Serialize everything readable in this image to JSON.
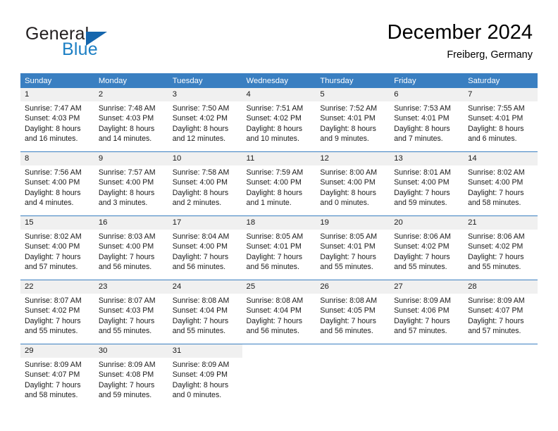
{
  "brand": {
    "word_one": "General",
    "word_two": "Blue",
    "logo_icon": "triangle-logo-icon",
    "accent_color": "#1566ad",
    "text_color": "#1c7fc4"
  },
  "header": {
    "month_title": "December 2024",
    "location": "Freiberg, Germany"
  },
  "calendar": {
    "header_background": "#3a7fc1",
    "day_number_background": "#f0f0f0",
    "weekdays": [
      "Sunday",
      "Monday",
      "Tuesday",
      "Wednesday",
      "Thursday",
      "Friday",
      "Saturday"
    ],
    "weeks": [
      [
        {
          "day": "1",
          "sunrise": "Sunrise: 7:47 AM",
          "sunset": "Sunset: 4:03 PM",
          "daylight_line1": "Daylight: 8 hours",
          "daylight_line2": "and 16 minutes."
        },
        {
          "day": "2",
          "sunrise": "Sunrise: 7:48 AM",
          "sunset": "Sunset: 4:03 PM",
          "daylight_line1": "Daylight: 8 hours",
          "daylight_line2": "and 14 minutes."
        },
        {
          "day": "3",
          "sunrise": "Sunrise: 7:50 AM",
          "sunset": "Sunset: 4:02 PM",
          "daylight_line1": "Daylight: 8 hours",
          "daylight_line2": "and 12 minutes."
        },
        {
          "day": "4",
          "sunrise": "Sunrise: 7:51 AM",
          "sunset": "Sunset: 4:02 PM",
          "daylight_line1": "Daylight: 8 hours",
          "daylight_line2": "and 10 minutes."
        },
        {
          "day": "5",
          "sunrise": "Sunrise: 7:52 AM",
          "sunset": "Sunset: 4:01 PM",
          "daylight_line1": "Daylight: 8 hours",
          "daylight_line2": "and 9 minutes."
        },
        {
          "day": "6",
          "sunrise": "Sunrise: 7:53 AM",
          "sunset": "Sunset: 4:01 PM",
          "daylight_line1": "Daylight: 8 hours",
          "daylight_line2": "and 7 minutes."
        },
        {
          "day": "7",
          "sunrise": "Sunrise: 7:55 AM",
          "sunset": "Sunset: 4:01 PM",
          "daylight_line1": "Daylight: 8 hours",
          "daylight_line2": "and 6 minutes."
        }
      ],
      [
        {
          "day": "8",
          "sunrise": "Sunrise: 7:56 AM",
          "sunset": "Sunset: 4:00 PM",
          "daylight_line1": "Daylight: 8 hours",
          "daylight_line2": "and 4 minutes."
        },
        {
          "day": "9",
          "sunrise": "Sunrise: 7:57 AM",
          "sunset": "Sunset: 4:00 PM",
          "daylight_line1": "Daylight: 8 hours",
          "daylight_line2": "and 3 minutes."
        },
        {
          "day": "10",
          "sunrise": "Sunrise: 7:58 AM",
          "sunset": "Sunset: 4:00 PM",
          "daylight_line1": "Daylight: 8 hours",
          "daylight_line2": "and 2 minutes."
        },
        {
          "day": "11",
          "sunrise": "Sunrise: 7:59 AM",
          "sunset": "Sunset: 4:00 PM",
          "daylight_line1": "Daylight: 8 hours",
          "daylight_line2": "and 1 minute."
        },
        {
          "day": "12",
          "sunrise": "Sunrise: 8:00 AM",
          "sunset": "Sunset: 4:00 PM",
          "daylight_line1": "Daylight: 8 hours",
          "daylight_line2": "and 0 minutes."
        },
        {
          "day": "13",
          "sunrise": "Sunrise: 8:01 AM",
          "sunset": "Sunset: 4:00 PM",
          "daylight_line1": "Daylight: 7 hours",
          "daylight_line2": "and 59 minutes."
        },
        {
          "day": "14",
          "sunrise": "Sunrise: 8:02 AM",
          "sunset": "Sunset: 4:00 PM",
          "daylight_line1": "Daylight: 7 hours",
          "daylight_line2": "and 58 minutes."
        }
      ],
      [
        {
          "day": "15",
          "sunrise": "Sunrise: 8:02 AM",
          "sunset": "Sunset: 4:00 PM",
          "daylight_line1": "Daylight: 7 hours",
          "daylight_line2": "and 57 minutes."
        },
        {
          "day": "16",
          "sunrise": "Sunrise: 8:03 AM",
          "sunset": "Sunset: 4:00 PM",
          "daylight_line1": "Daylight: 7 hours",
          "daylight_line2": "and 56 minutes."
        },
        {
          "day": "17",
          "sunrise": "Sunrise: 8:04 AM",
          "sunset": "Sunset: 4:00 PM",
          "daylight_line1": "Daylight: 7 hours",
          "daylight_line2": "and 56 minutes."
        },
        {
          "day": "18",
          "sunrise": "Sunrise: 8:05 AM",
          "sunset": "Sunset: 4:01 PM",
          "daylight_line1": "Daylight: 7 hours",
          "daylight_line2": "and 56 minutes."
        },
        {
          "day": "19",
          "sunrise": "Sunrise: 8:05 AM",
          "sunset": "Sunset: 4:01 PM",
          "daylight_line1": "Daylight: 7 hours",
          "daylight_line2": "and 55 minutes."
        },
        {
          "day": "20",
          "sunrise": "Sunrise: 8:06 AM",
          "sunset": "Sunset: 4:02 PM",
          "daylight_line1": "Daylight: 7 hours",
          "daylight_line2": "and 55 minutes."
        },
        {
          "day": "21",
          "sunrise": "Sunrise: 8:06 AM",
          "sunset": "Sunset: 4:02 PM",
          "daylight_line1": "Daylight: 7 hours",
          "daylight_line2": "and 55 minutes."
        }
      ],
      [
        {
          "day": "22",
          "sunrise": "Sunrise: 8:07 AM",
          "sunset": "Sunset: 4:02 PM",
          "daylight_line1": "Daylight: 7 hours",
          "daylight_line2": "and 55 minutes."
        },
        {
          "day": "23",
          "sunrise": "Sunrise: 8:07 AM",
          "sunset": "Sunset: 4:03 PM",
          "daylight_line1": "Daylight: 7 hours",
          "daylight_line2": "and 55 minutes."
        },
        {
          "day": "24",
          "sunrise": "Sunrise: 8:08 AM",
          "sunset": "Sunset: 4:04 PM",
          "daylight_line1": "Daylight: 7 hours",
          "daylight_line2": "and 55 minutes."
        },
        {
          "day": "25",
          "sunrise": "Sunrise: 8:08 AM",
          "sunset": "Sunset: 4:04 PM",
          "daylight_line1": "Daylight: 7 hours",
          "daylight_line2": "and 56 minutes."
        },
        {
          "day": "26",
          "sunrise": "Sunrise: 8:08 AM",
          "sunset": "Sunset: 4:05 PM",
          "daylight_line1": "Daylight: 7 hours",
          "daylight_line2": "and 56 minutes."
        },
        {
          "day": "27",
          "sunrise": "Sunrise: 8:09 AM",
          "sunset": "Sunset: 4:06 PM",
          "daylight_line1": "Daylight: 7 hours",
          "daylight_line2": "and 57 minutes."
        },
        {
          "day": "28",
          "sunrise": "Sunrise: 8:09 AM",
          "sunset": "Sunset: 4:07 PM",
          "daylight_line1": "Daylight: 7 hours",
          "daylight_line2": "and 57 minutes."
        }
      ],
      [
        {
          "day": "29",
          "sunrise": "Sunrise: 8:09 AM",
          "sunset": "Sunset: 4:07 PM",
          "daylight_line1": "Daylight: 7 hours",
          "daylight_line2": "and 58 minutes."
        },
        {
          "day": "30",
          "sunrise": "Sunrise: 8:09 AM",
          "sunset": "Sunset: 4:08 PM",
          "daylight_line1": "Daylight: 7 hours",
          "daylight_line2": "and 59 minutes."
        },
        {
          "day": "31",
          "sunrise": "Sunrise: 8:09 AM",
          "sunset": "Sunset: 4:09 PM",
          "daylight_line1": "Daylight: 8 hours",
          "daylight_line2": "and 0 minutes."
        },
        {
          "day": "",
          "sunrise": "",
          "sunset": "",
          "daylight_line1": "",
          "daylight_line2": ""
        },
        {
          "day": "",
          "sunrise": "",
          "sunset": "",
          "daylight_line1": "",
          "daylight_line2": ""
        },
        {
          "day": "",
          "sunrise": "",
          "sunset": "",
          "daylight_line1": "",
          "daylight_line2": ""
        },
        {
          "day": "",
          "sunrise": "",
          "sunset": "",
          "daylight_line1": "",
          "daylight_line2": ""
        }
      ]
    ]
  }
}
